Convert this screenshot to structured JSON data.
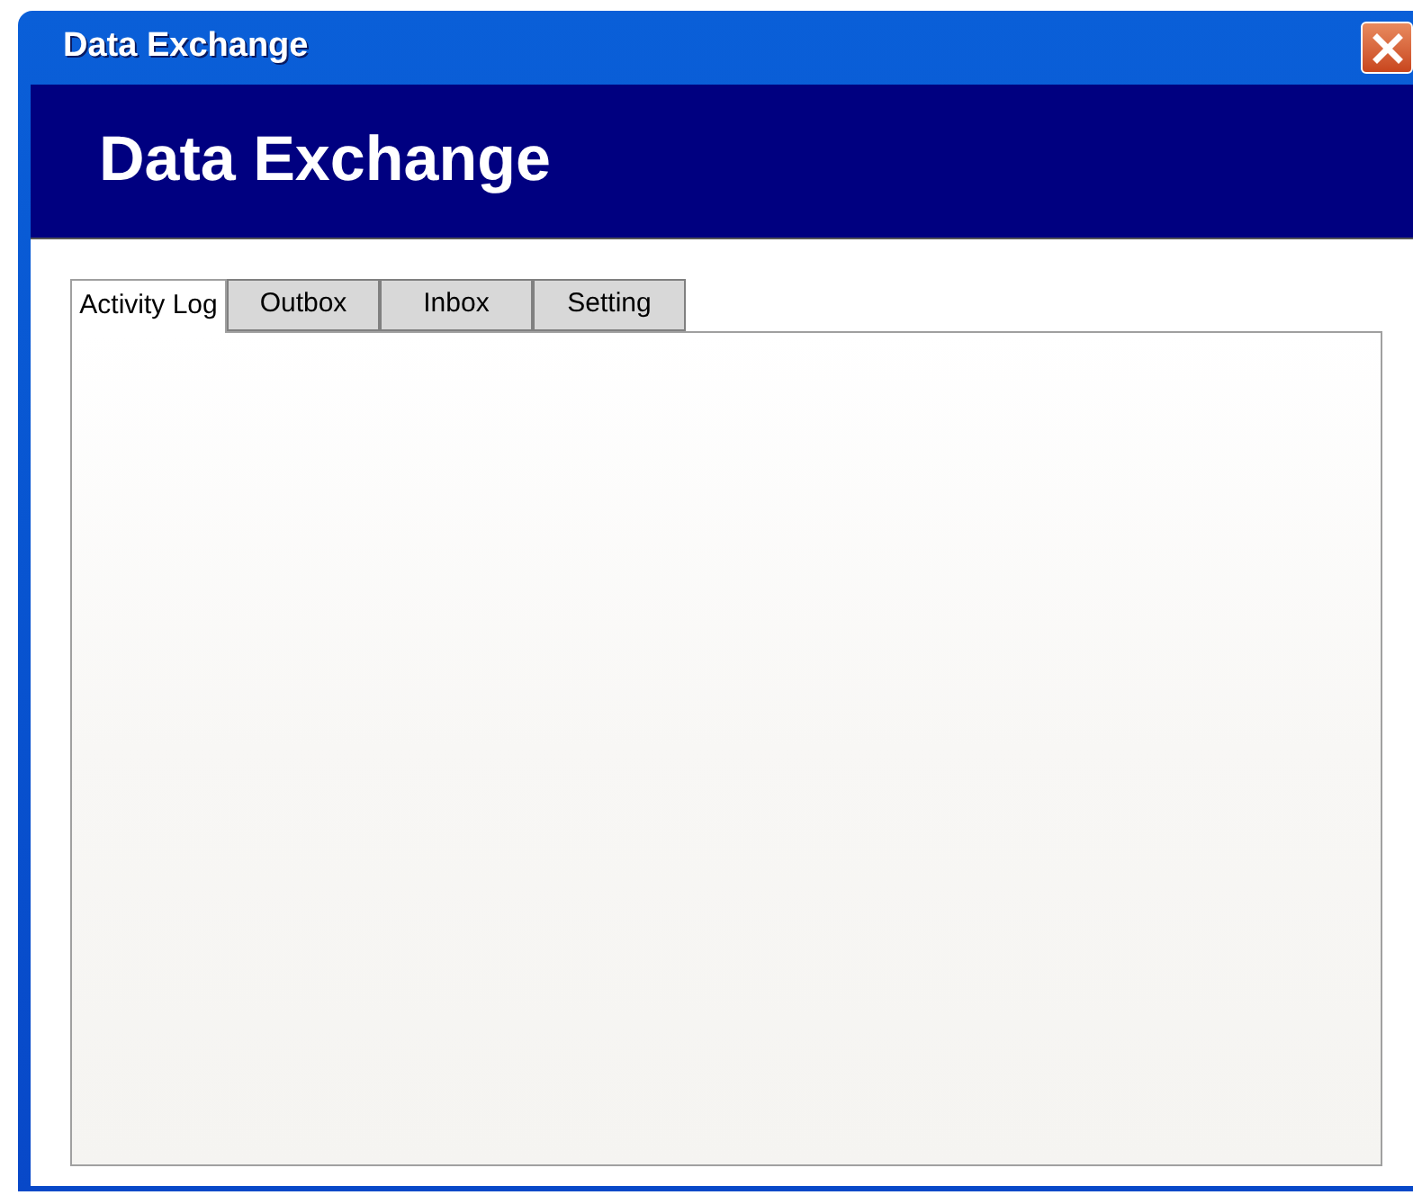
{
  "window": {
    "title": "Data Exchange"
  },
  "header": {
    "title": "Data Exchange"
  },
  "tabs": [
    {
      "label": "Activity Log",
      "selected": true
    },
    {
      "label": "Outbox",
      "selected": false
    },
    {
      "label": "Inbox",
      "selected": false
    },
    {
      "label": "Setting",
      "selected": false
    }
  ]
}
